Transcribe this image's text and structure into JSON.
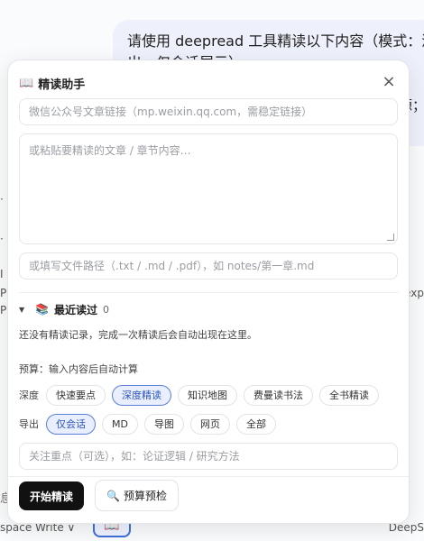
{
  "background": {
    "bubble_line1": "请使用 deepread 工具精读以下内容（模式：深",
    "bubble_line2": "出，仅会话展示）",
    "bubble_right_fragment": "源；",
    "left_fragments": [
      "·",
      "·",
      "I",
      "P",
      "P"
    ],
    "right_fragment": "exp",
    "bottom_left": "space Write ∨",
    "bottom_right": "DeepS",
    "left_edge_char": "息",
    "book_button_icon": "📖"
  },
  "panel": {
    "title_icon": "📖",
    "title": "精读助手",
    "close_icon": "×",
    "url_placeholder": "微信公众号文章链接（mp.weixin.qq.com，需稳定链接）",
    "text_placeholder": "或粘贴要精读的文章 / 章节内容…",
    "path_placeholder": "或填写文件路径（.txt / .md / .pdf），如 notes/第一章.md",
    "recent": {
      "caret": "▼",
      "icon": "📚",
      "label": "最近读过",
      "count": "0",
      "empty_text": "还没有精读记录，完成一次精读后会自动出现在这里。"
    },
    "budget_text": "预算：输入内容后自动计算",
    "depth": {
      "label": "深度",
      "options": [
        "快速要点",
        "深度精读",
        "知识地图",
        "费曼读书法",
        "全书精读"
      ],
      "selected": "深度精读"
    },
    "export": {
      "label": "导出",
      "options": [
        "仅会话",
        "MD",
        "导图",
        "网页",
        "全部"
      ],
      "selected": "仅会话"
    },
    "focus_placeholder": "关注重点（可选），如：论证逻辑 / 研究方法",
    "start_button": "开始精读",
    "precheck_icon": "🔍",
    "precheck_button": "预算预检"
  },
  "colors": {
    "accent": "#2d55b8",
    "accent_bg": "#e9efff",
    "primary_button": "#111111"
  }
}
